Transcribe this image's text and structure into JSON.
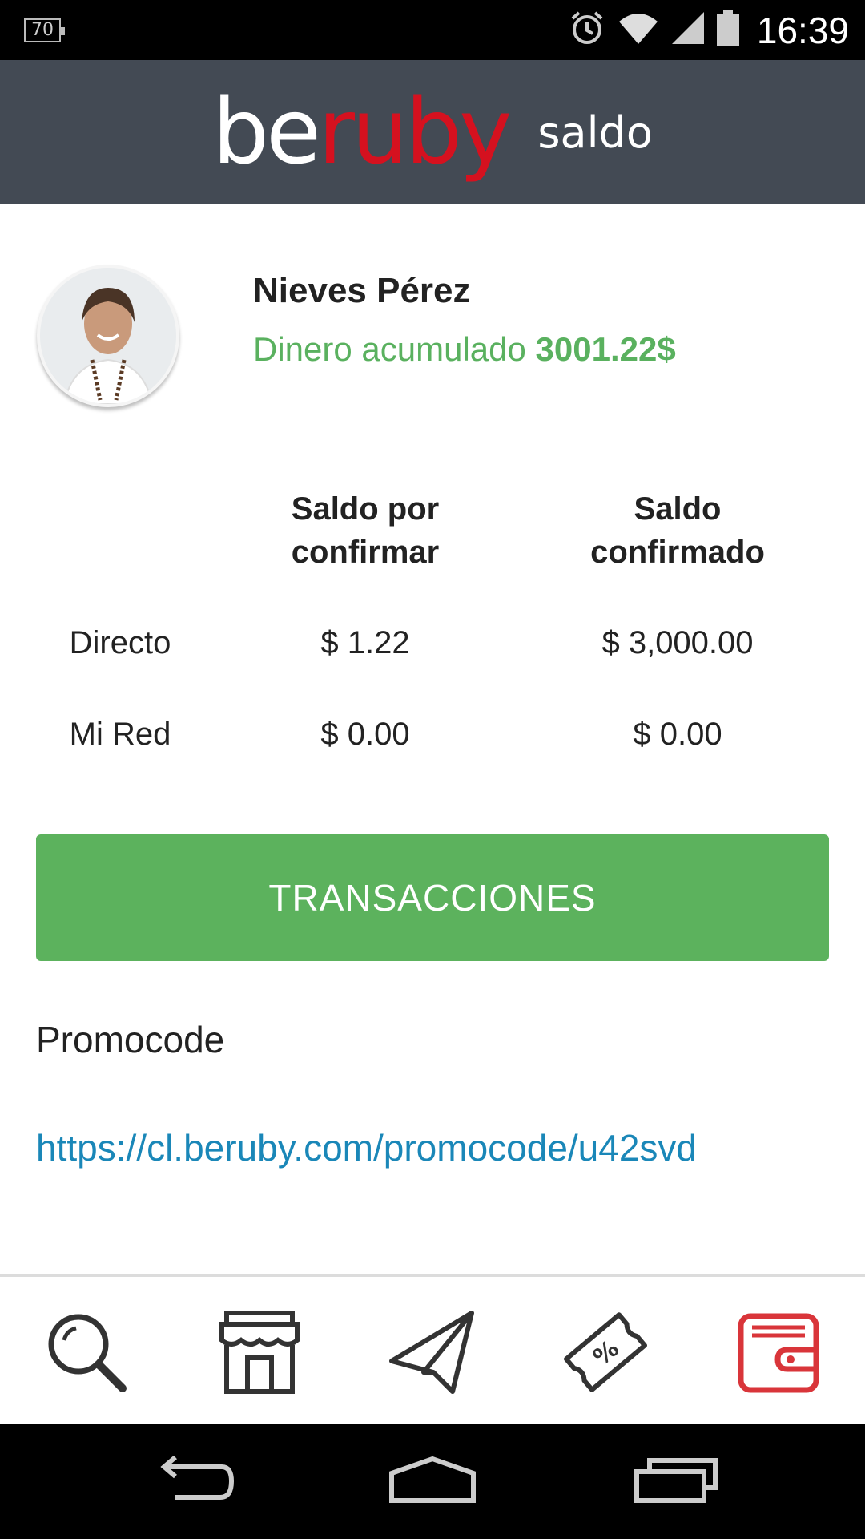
{
  "status_bar": {
    "battery_level": "70",
    "time": "16:39",
    "icons": [
      "alarm-icon",
      "wifi-icon",
      "signal-icon",
      "battery-icon"
    ]
  },
  "header": {
    "logo_be": "be",
    "logo_ruby": "ruby",
    "title": "saldo"
  },
  "profile": {
    "name": "Nieves Pérez",
    "accumulated_label": "Dinero acumulado",
    "accumulated_value": "3001.22$"
  },
  "balance_table": {
    "col_pending": "Saldo por confirmar",
    "col_confirmed": "Saldo confirmado",
    "rows": [
      {
        "label": "Directo",
        "pending": "$ 1.22",
        "confirmed": "$ 3,000.00"
      },
      {
        "label": "Mi Red",
        "pending": "$ 0.00",
        "confirmed": "$ 0.00"
      }
    ]
  },
  "transactions_button": "TRANSACCIONES",
  "promocode": {
    "title": "Promocode",
    "link": "https://cl.beruby.com/promocode/u42svd"
  },
  "bottom_nav": {
    "items": [
      "search-icon",
      "store-icon",
      "paper-plane-icon",
      "discount-ticket-icon",
      "wallet-icon"
    ],
    "active": "wallet-icon"
  },
  "colors": {
    "header_bg": "#434a54",
    "brand_red": "#d5111f",
    "green": "#5cb25d",
    "link_blue": "#1a87b8"
  }
}
